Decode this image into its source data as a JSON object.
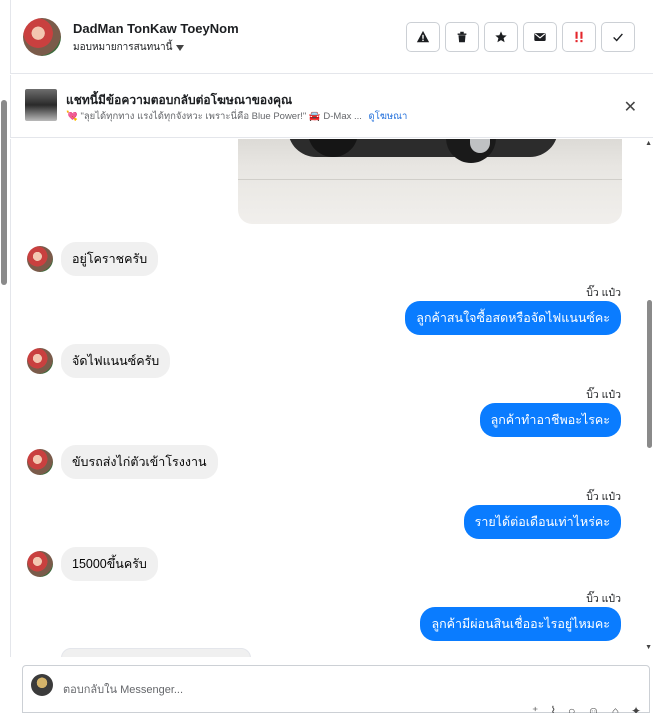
{
  "header": {
    "name": "DadMan TonKaw ToeyNom",
    "assign_label": "มอบหมายการสนทนานี้",
    "tools": [
      {
        "icon": "warning-icon",
        "glyph": "⚠"
      },
      {
        "icon": "trash-icon",
        "glyph": "🗑"
      },
      {
        "icon": "star-icon",
        "glyph": "★"
      },
      {
        "icon": "mail-icon",
        "glyph": "✉"
      },
      {
        "icon": "follow-up-icon",
        "glyph": "‼"
      },
      {
        "icon": "check-icon",
        "glyph": "✓"
      }
    ]
  },
  "banner": {
    "title": "แชทนี้มีข้อความตอบกลับต่อโฆษณาของคุณ",
    "subtitle": "💘 \"ลุยได้ทุกทาง แรงได้ทุกจังหวะ เพราะนี่คือ Blue Power!\" 🚘 D-Max ...",
    "link": "ดูโฆษณา",
    "close": "✕"
  },
  "messages": [
    {
      "dir": "in",
      "text": "อยู่โคราชครับ"
    },
    {
      "dir": "out",
      "seen": "บิ๊ว แป๋ว",
      "text": "ลูกค้าสนใจซื้อสดหรือจัดไฟแนนซ์คะ"
    },
    {
      "dir": "in",
      "text": "จัดไฟแนนซ์ครับ"
    },
    {
      "dir": "out",
      "seen": "บิ๊ว แป๋ว",
      "text": "ลูกค้าทำอาชีพอะไรคะ"
    },
    {
      "dir": "in",
      "text": "ขับรถส่งไก่ตัวเข้าโรงงาน"
    },
    {
      "dir": "out",
      "seen": "บิ๊ว แป๋ว",
      "text": "รายได้ต่อเดือนเท่าไหร่คะ"
    },
    {
      "dir": "in",
      "text": "15000ขึ้นครับ"
    },
    {
      "dir": "out",
      "seen": "บิ๊ว แป๋ว",
      "text": "ลูกค้ามีผ่อนสินเชื่ออะไรอยู่ไหมคะ"
    }
  ],
  "composer": {
    "placeholder": "ตอบกลับใน Messenger..."
  }
}
